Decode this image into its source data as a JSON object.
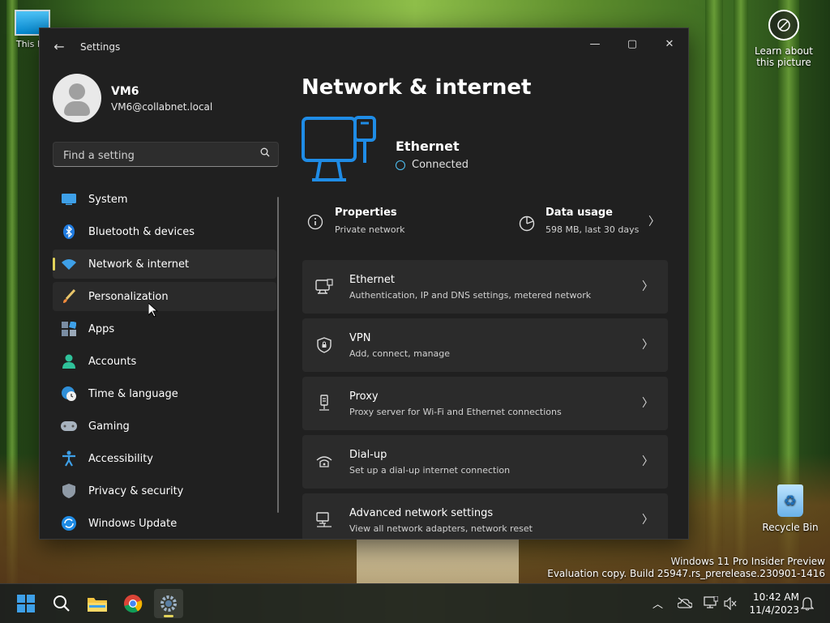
{
  "desktop": {
    "this_pc_label": "This PC",
    "learn_label_line1": "Learn about",
    "learn_label_line2": "this picture",
    "recycle_label": "Recycle Bin",
    "watermark_line1": "Windows 11 Pro Insider Preview",
    "watermark_line2": "Evaluation copy. Build 25947.rs_prerelease.230901-1416"
  },
  "window": {
    "title": "Settings",
    "controls": {
      "minimize": "—",
      "maximize": "▢",
      "close": "✕"
    }
  },
  "user": {
    "name": "VM6",
    "email": "VM6@collabnet.local"
  },
  "search": {
    "placeholder": "Find a setting"
  },
  "nav": {
    "items": [
      {
        "label": "System",
        "icon": "monitor-icon"
      },
      {
        "label": "Bluetooth & devices",
        "icon": "bluetooth-icon"
      },
      {
        "label": "Network & internet",
        "icon": "wifi-icon",
        "active": true
      },
      {
        "label": "Personalization",
        "icon": "brush-icon",
        "hover": true
      },
      {
        "label": "Apps",
        "icon": "apps-icon"
      },
      {
        "label": "Accounts",
        "icon": "person-icon"
      },
      {
        "label": "Time & language",
        "icon": "clock-globe-icon"
      },
      {
        "label": "Gaming",
        "icon": "controller-icon"
      },
      {
        "label": "Accessibility",
        "icon": "accessibility-icon"
      },
      {
        "label": "Privacy & security",
        "icon": "shield-icon"
      },
      {
        "label": "Windows Update",
        "icon": "update-icon"
      }
    ]
  },
  "main": {
    "title": "Network & internet",
    "hero": {
      "name": "Ethernet",
      "status": "Connected"
    },
    "properties": {
      "title": "Properties",
      "subtitle": "Private network"
    },
    "data_usage": {
      "title": "Data usage",
      "subtitle": "598 MB, last 30 days"
    },
    "cards": [
      {
        "title": "Ethernet",
        "subtitle": "Authentication, IP and DNS settings, metered network",
        "icon": "ethernet-icon"
      },
      {
        "title": "VPN",
        "subtitle": "Add, connect, manage",
        "icon": "vpn-shield-icon"
      },
      {
        "title": "Proxy",
        "subtitle": "Proxy server for Wi-Fi and Ethernet connections",
        "icon": "proxy-icon"
      },
      {
        "title": "Dial-up",
        "subtitle": "Set up a dial-up internet connection",
        "icon": "dialup-icon"
      },
      {
        "title": "Advanced network settings",
        "subtitle": "View all network adapters, network reset",
        "icon": "advanced-network-icon"
      }
    ]
  },
  "taskbar": {
    "time": "10:42 AM",
    "date": "11/4/2023"
  },
  "colors": {
    "accent": "#1f8ce6",
    "active_pill": "#e2d35a",
    "window_bg": "#202020",
    "card_bg": "#2b2b2b"
  }
}
